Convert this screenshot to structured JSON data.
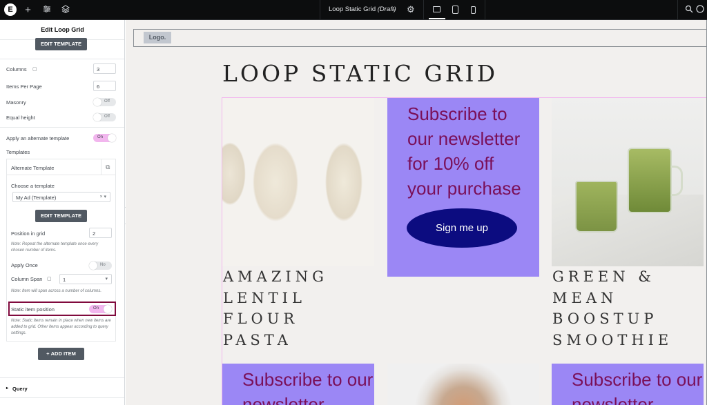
{
  "topbar": {
    "logo_text": "E",
    "add_icon": "plus-icon",
    "settings_icon": "sliders-icon",
    "layers_icon": "layers-icon",
    "doc_title": "Loop Static Grid",
    "doc_status": "(Draft)",
    "devices": [
      "desktop-icon",
      "tablet-icon",
      "mobile-icon"
    ],
    "search_icon": "search-icon"
  },
  "panel": {
    "title": "Edit Loop Grid",
    "edit_template_top": "EDIT TEMPLATE",
    "columns_label": "Columns",
    "columns_value": "3",
    "items_per_page_label": "Items Per Page",
    "items_per_page_value": "6",
    "masonry_label": "Masonry",
    "masonry_state": "Off",
    "equal_height_label": "Equal height",
    "equal_height_state": "Off",
    "alt_template_label": "Apply an alternate template",
    "alt_template_state": "On",
    "templates_label": "Templates",
    "alt_box_title": "Alternate Template",
    "choose_template_label": "Choose a template",
    "choose_template_value": "My Ad (Template)",
    "edit_template_inner": "EDIT TEMPLATE",
    "position_label": "Position in grid",
    "position_value": "2",
    "position_note": "Note: Repeat the alternate template once every chosen number of items.",
    "apply_once_label": "Apply Once",
    "apply_once_state": "No",
    "column_span_label": "Column Span",
    "column_span_value": "1",
    "column_span_note": "Note: Item will span across a number of columns.",
    "static_label": "Static item position",
    "static_state": "On",
    "static_note": "Note: Static Items remain in place when new items are added to grid. Other items appear according to query settings.",
    "add_item_label": "ADD ITEM",
    "query_label": "Query"
  },
  "canvas": {
    "logo": "Logo.",
    "page_title": "LOOP STATIC GRID",
    "promo_text": "Subscribe to our newsletter for 10% off your purchase",
    "promo_text_partial": "Subscribe to our newsletter",
    "cta_label": "Sign me up",
    "card1_title": "AMAZING LENTIL FLOUR PASTA",
    "card3_title": "GREEN & MEAN BOOSTUP SMOOTHIE"
  },
  "colors": {
    "promo_bg": "#9b87f5",
    "promo_text": "#7a1059",
    "cta_bg": "#0c0c80",
    "toggle_on": "#f2b6ee",
    "highlight_border": "#800a3d"
  }
}
